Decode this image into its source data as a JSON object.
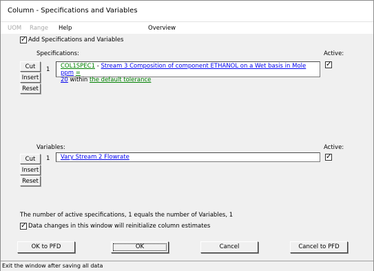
{
  "window": {
    "title": "Column - Specifications and Variables"
  },
  "menu": {
    "uom": "UOM",
    "range": "Range",
    "help": "Help",
    "overview": "Overview"
  },
  "add_checkbox_label": "Add Specifications and Variables",
  "specifications": {
    "header": "Specifications:",
    "active_header": "Active:",
    "buttons": {
      "cut": "Cut",
      "insert": "Insert",
      "reset": "Reset"
    },
    "row": {
      "index": "1",
      "id": "COL1SPEC1",
      "sep": " - ",
      "desc": "Stream 3 Composition of component ETHANOL on a Wet basis in Mole ppm",
      "eq": "=",
      "value": "20",
      "within": " within ",
      "tolerance": "the default tolerance"
    }
  },
  "variables": {
    "header": "Variables:",
    "active_header": "Active:",
    "buttons": {
      "cut": "Cut",
      "insert": "Insert",
      "reset": "Reset"
    },
    "row": {
      "index": "1",
      "desc": "Vary Stream 2 Flowrate"
    }
  },
  "summary_text": "The number of active specifications, 1 equals the number of Variables, 1",
  "data_changes_label": "Data changes in this window will reinitialize column estimates",
  "bottom_buttons": {
    "ok_pfd": "OK to PFD",
    "ok": "OK",
    "cancel": "Cancel",
    "cancel_pfd": "Cancel to PFD"
  },
  "status_text": "Exit the window after saving all data"
}
